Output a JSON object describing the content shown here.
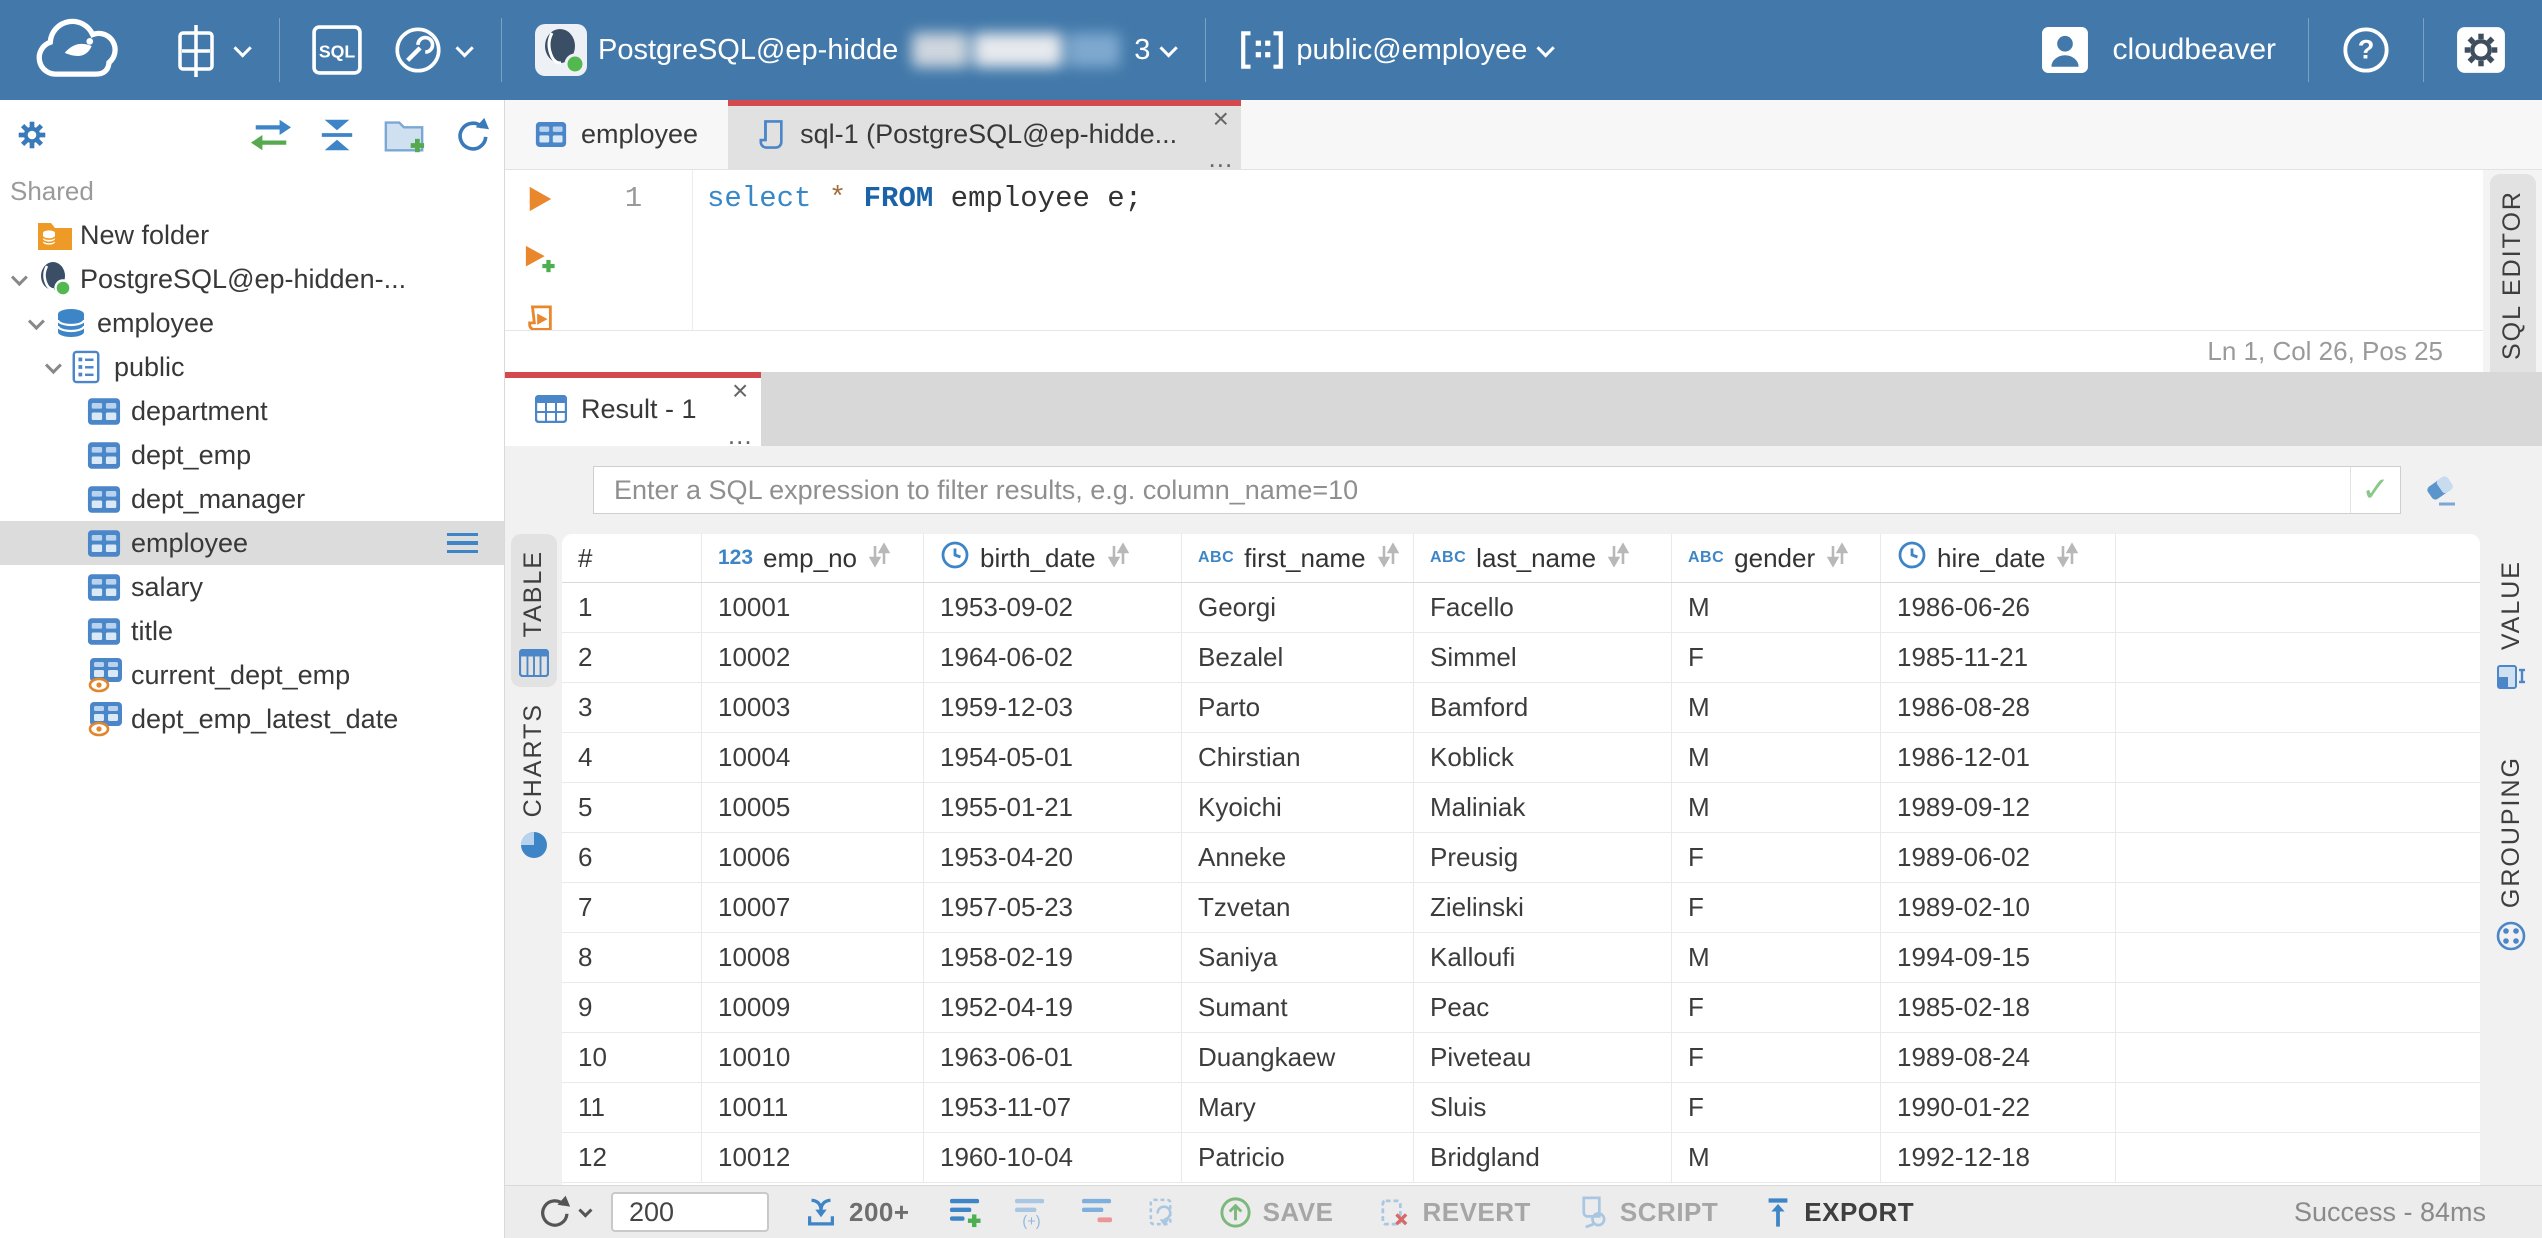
{
  "topbar": {
    "sql_badge": "SQL",
    "connection_name": "PostgreSQL@ep-hidde",
    "connection_suffix": "3",
    "schema_selector": "public@employee",
    "username": "cloudbeaver",
    "help_glyph": "?"
  },
  "sidebar": {
    "section_label": "Shared",
    "tree": [
      {
        "label": "New folder",
        "level": 1,
        "icon": "folderdb",
        "chevron": false,
        "selected": false
      },
      {
        "label": "PostgreSQL@ep-hidden-...",
        "level": 1,
        "icon": "postgres",
        "chevron": true,
        "selected": false
      },
      {
        "label": "employee",
        "level": 2,
        "icon": "database",
        "chevron": true,
        "selected": false
      },
      {
        "label": "public",
        "level": 3,
        "icon": "schema",
        "chevron": true,
        "selected": false
      },
      {
        "label": "department",
        "level": 4,
        "icon": "table",
        "chevron": false,
        "selected": false
      },
      {
        "label": "dept_emp",
        "level": 4,
        "icon": "table",
        "chevron": false,
        "selected": false
      },
      {
        "label": "dept_manager",
        "level": 4,
        "icon": "table",
        "chevron": false,
        "selected": false
      },
      {
        "label": "employee",
        "level": 4,
        "icon": "table",
        "chevron": false,
        "selected": true
      },
      {
        "label": "salary",
        "level": 4,
        "icon": "table",
        "chevron": false,
        "selected": false
      },
      {
        "label": "title",
        "level": 4,
        "icon": "table",
        "chevron": false,
        "selected": false
      },
      {
        "label": "current_dept_emp",
        "level": 4,
        "icon": "view",
        "chevron": false,
        "selected": false
      },
      {
        "label": "dept_emp_latest_date",
        "level": 4,
        "icon": "view",
        "chevron": false,
        "selected": false
      }
    ]
  },
  "tabs": {
    "employee_tab": "employee",
    "sql_tab": "sql-1 (PostgreSQL@ep-hidde...",
    "result_tab": "Result - 1",
    "close_glyph": "×",
    "menu_glyph": "..."
  },
  "editor": {
    "line_number": "1",
    "kw_select": "select",
    "star": "*",
    "kw_from": "FROM",
    "code_rest": "employee e;",
    "status": "Ln 1, Col 26, Pos 25"
  },
  "panel_tabs": {
    "table": "TABLE",
    "charts": "CHARTS",
    "value": "VALUE",
    "grouping": "GROUPING",
    "sql_editor": "SQL EDITOR"
  },
  "filter": {
    "placeholder": "Enter a SQL expression to filter results, e.g. column_name=10",
    "apply_glyph": "✓"
  },
  "grid": {
    "columns": [
      {
        "label": "#",
        "type": "rowid"
      },
      {
        "label": "emp_no",
        "type": "number"
      },
      {
        "label": "birth_date",
        "type": "datetime"
      },
      {
        "label": "first_name",
        "type": "string"
      },
      {
        "label": "last_name",
        "type": "string"
      },
      {
        "label": "gender",
        "type": "string"
      },
      {
        "label": "hire_date",
        "type": "datetime"
      }
    ],
    "rows": [
      [
        "1",
        "10001",
        "1953-09-02",
        "Georgi",
        "Facello",
        "M",
        "1986-06-26"
      ],
      [
        "2",
        "10002",
        "1964-06-02",
        "Bezalel",
        "Simmel",
        "F",
        "1985-11-21"
      ],
      [
        "3",
        "10003",
        "1959-12-03",
        "Parto",
        "Bamford",
        "M",
        "1986-08-28"
      ],
      [
        "4",
        "10004",
        "1954-05-01",
        "Chirstian",
        "Koblick",
        "M",
        "1986-12-01"
      ],
      [
        "5",
        "10005",
        "1955-01-21",
        "Kyoichi",
        "Maliniak",
        "M",
        "1989-09-12"
      ],
      [
        "6",
        "10006",
        "1953-04-20",
        "Anneke",
        "Preusig",
        "F",
        "1989-06-02"
      ],
      [
        "7",
        "10007",
        "1957-05-23",
        "Tzvetan",
        "Zielinski",
        "F",
        "1989-02-10"
      ],
      [
        "8",
        "10008",
        "1958-02-19",
        "Saniya",
        "Kalloufi",
        "M",
        "1994-09-15"
      ],
      [
        "9",
        "10009",
        "1952-04-19",
        "Sumant",
        "Peac",
        "F",
        "1985-02-18"
      ],
      [
        "10",
        "10010",
        "1963-06-01",
        "Duangkaew",
        "Piveteau",
        "F",
        "1989-08-24"
      ],
      [
        "11",
        "10011",
        "1953-11-07",
        "Mary",
        "Sluis",
        "F",
        "1990-01-22"
      ],
      [
        "12",
        "10012",
        "1960-10-04",
        "Patricio",
        "Bridgland",
        "M",
        "1992-12-18"
      ]
    ]
  },
  "toolbar": {
    "row_limit": "200",
    "fetch_more": "200+",
    "save": "SAVE",
    "revert": "REVERT",
    "script": "SCRIPT",
    "export": "EXPORT",
    "status": "Success - 84ms"
  },
  "colors": {
    "topbar_blue": "#4279aa",
    "accent_red": "#d4494d",
    "icon_blue": "#3d85c6",
    "green": "#57a94f",
    "orange": "#e8872c"
  }
}
